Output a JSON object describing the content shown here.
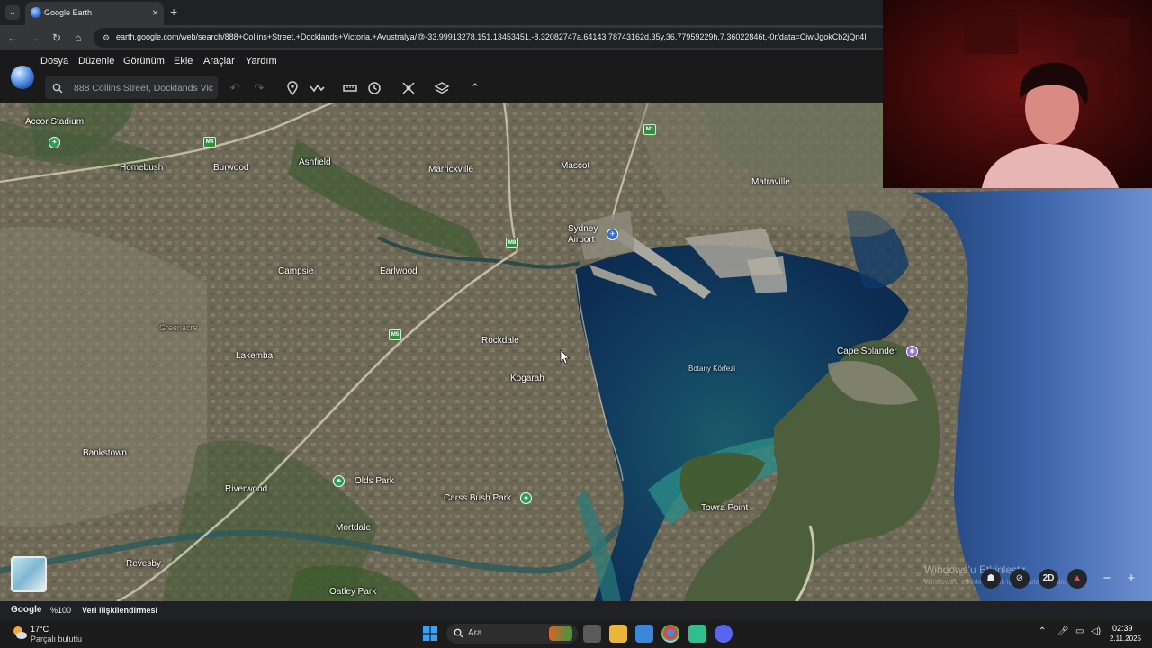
{
  "browser": {
    "tab_title": "Google Earth",
    "url": "earth.google.com/web/search/888+Collins+Street,+Docklands+Victoria,+Avustralya/@-33.99913278,151.13453451,-8.32082747a,64143.78743162d,35y,36.77959229h,7.36022846t,-0r/data=CiwiJgokCb2jQn4I"
  },
  "earth": {
    "menu": [
      "Dosya",
      "Düzenle",
      "Görünüm",
      "Ekle",
      "Araçlar",
      "Yardım"
    ],
    "search_placeholder": "888 Collins Street, Docklands Vic"
  },
  "map": {
    "places": [
      {
        "name": "Accor Stadium",
        "kind": "land"
      },
      {
        "name": "Homebush",
        "kind": "land"
      },
      {
        "name": "Burwood",
        "kind": "land"
      },
      {
        "name": "Ashfield",
        "kind": "land"
      },
      {
        "name": "Marrickville",
        "kind": "land"
      },
      {
        "name": "Mascot",
        "kind": "land"
      },
      {
        "name": "Matraville",
        "kind": "land"
      },
      {
        "name": "Sydney",
        "kind": "land"
      },
      {
        "name": "Airport",
        "kind": "land"
      },
      {
        "name": "Campsie",
        "kind": "land"
      },
      {
        "name": "Earlwood",
        "kind": "land"
      },
      {
        "name": "Greenacre",
        "kind": "faint"
      },
      {
        "name": "Lakemba",
        "kind": "land"
      },
      {
        "name": "Rockdale",
        "kind": "land"
      },
      {
        "name": "Kogarah",
        "kind": "land"
      },
      {
        "name": "Botany Körfezi",
        "kind": "water"
      },
      {
        "name": "Cape Solander",
        "kind": "land"
      },
      {
        "name": "Bankstown",
        "kind": "land"
      },
      {
        "name": "Riverwood",
        "kind": "land"
      },
      {
        "name": "Olds Park",
        "kind": "land"
      },
      {
        "name": "Carss Bush Park",
        "kind": "land"
      },
      {
        "name": "Towra Point",
        "kind": "land"
      },
      {
        "name": "Mortdale",
        "kind": "land"
      },
      {
        "name": "Revesby",
        "kind": "land"
      },
      {
        "name": "Oatley Park",
        "kind": "land"
      }
    ],
    "road_shields": [
      "M4",
      "M1",
      "M8",
      "M5"
    ],
    "watermark_line1": "Windows'u Etkinleştir",
    "watermark_line2": "Windows'u etkinleştirmek için Ayarlar'a gidin.",
    "view_mode": "2D"
  },
  "status": {
    "brand": "Google",
    "zoom": "%100",
    "attribution": "Veri ilişkilendirmesi"
  },
  "taskbar": {
    "temperature": "17°C",
    "condition": "Parçalı bulutlu",
    "search": "Ara",
    "time": "02:39",
    "date": "2.11.2025"
  },
  "colors": {
    "water_deep": "#0d2c52",
    "water_shallow": "#2a8a86",
    "land": "#6b6653",
    "park_pin": "#2e9e57",
    "poi_pin": "#9a6ae0",
    "airport_pin": "#2f6fd6"
  }
}
